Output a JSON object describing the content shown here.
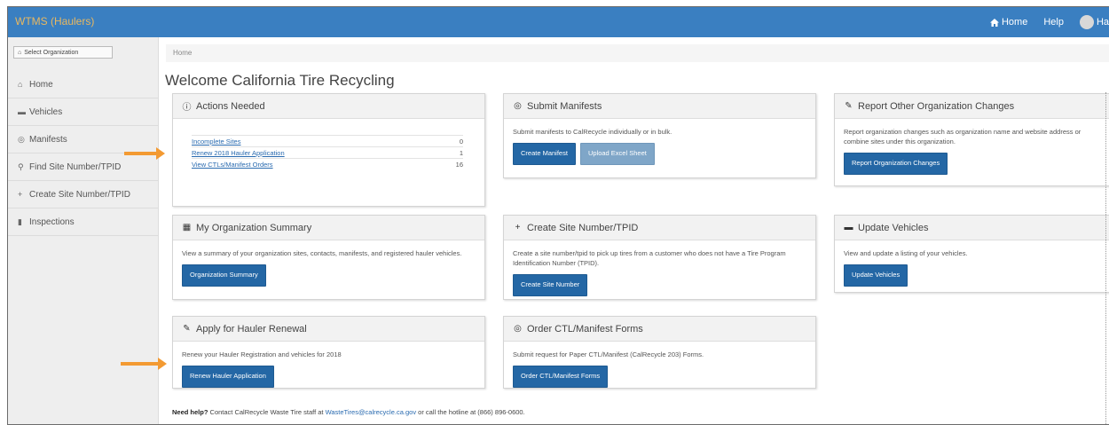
{
  "app": {
    "title": "WTMS (Haulers)"
  },
  "topnav": {
    "home": "Home",
    "help": "Help",
    "user": "Ha"
  },
  "sidebar": {
    "select_org": "Select Organization",
    "items": [
      {
        "label": "Home",
        "icon": "home-icon"
      },
      {
        "label": "Vehicles",
        "icon": "truck-icon"
      },
      {
        "label": "Manifests",
        "icon": "manifest-icon"
      },
      {
        "label": "Find Site Number/TPID",
        "icon": "map-marker-icon"
      },
      {
        "label": "Create Site Number/TPID",
        "icon": "plus-icon"
      },
      {
        "label": "Inspections",
        "icon": "clipboard-icon"
      }
    ]
  },
  "breadcrumb": "Home",
  "page_title": "Welcome California Tire Recycling",
  "panels": {
    "actions": {
      "title": "Actions Needed",
      "rows": [
        {
          "label": "Incomplete Sites",
          "count": "0"
        },
        {
          "label": "Renew 2018 Hauler Application",
          "count": "1"
        },
        {
          "label": "View CTLs/Manifest Orders",
          "count": "16"
        }
      ]
    },
    "submit": {
      "title": "Submit Manifests",
      "text": "Submit manifests to CalRecycle individually or in bulk.",
      "btn1": "Create Manifest",
      "btn2": "Upload Excel Sheet"
    },
    "report": {
      "title": "Report Other Organization Changes",
      "text": "Report organization changes such as organization name and website address or combine sites under this organization.",
      "btn": "Report Organization Changes"
    },
    "summary": {
      "title": "My Organization Summary",
      "text": "View a summary of your organization sites, contacts, manifests, and registered hauler vehicles.",
      "btn": "Organization Summary"
    },
    "create_site": {
      "title": "Create Site Number/TPID",
      "text": "Create a site number/tpid to pick up tires from a customer who does not have a Tire Program Identification Number (TPID).",
      "btn": "Create Site Number"
    },
    "vehicles": {
      "title": "Update Vehicles",
      "text": "View and update a listing of your vehicles.",
      "btn": "Update Vehicles"
    },
    "renewal": {
      "title": "Apply for Hauler Renewal",
      "text": "Renew your Hauler Registration and vehicles for 2018",
      "btn": "Renew Hauler Application"
    },
    "order": {
      "title": "Order CTL/Manifest Forms",
      "text": "Submit request for Paper CTL/Manifest (CalRecycle 203) Forms.",
      "btn": "Order CTL/Manifest Forms"
    }
  },
  "help": {
    "lead": "Need help?",
    "text1": " Contact CalRecycle Waste Tire staff at ",
    "email": "WasteTires@calrecycle.ca.gov",
    "text2": " or call the hotline at (866) 896-0600."
  },
  "colors": {
    "topbar": "#3a7fc1",
    "button": "#2467a5",
    "arrow": "#f39a32",
    "link": "#2a6bb0"
  }
}
